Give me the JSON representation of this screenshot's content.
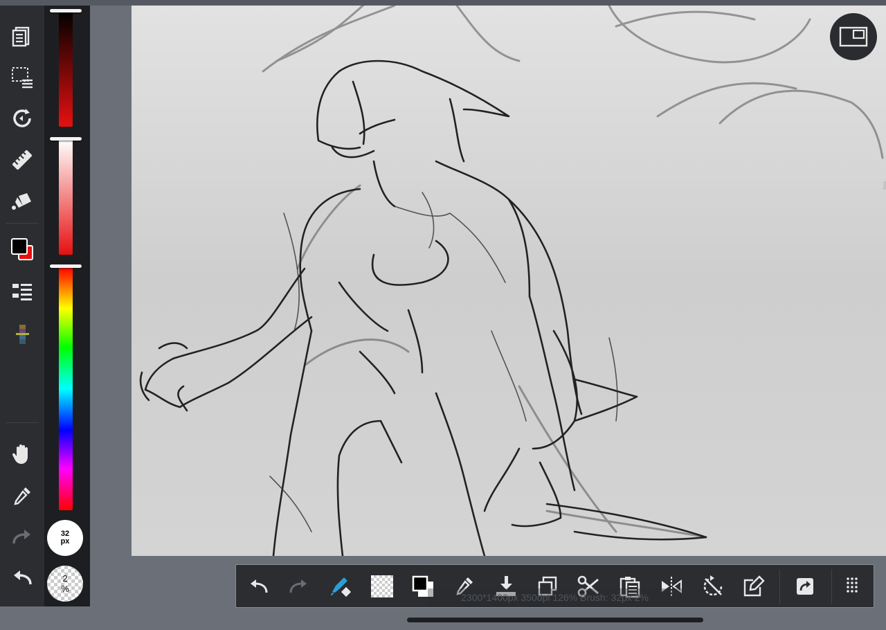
{
  "status_bar": {
    "text": "2300*1400px 350dpi 126% Brush: 32px 2%"
  },
  "brush": {
    "size_label": "32\npx",
    "opacity_value": "2",
    "opacity_unit": "%"
  },
  "colors": {
    "primary": "#000000",
    "secondary": "#e61010",
    "ui_dark": "#2b2d31",
    "accent_blue": "#2a9fd8"
  },
  "left_tools": [
    {
      "name": "layers-icon"
    },
    {
      "name": "selection-icon"
    },
    {
      "name": "transform-icon"
    },
    {
      "name": "ruler-icon"
    },
    {
      "name": "fill-icon"
    },
    {
      "name": "color-swatch"
    },
    {
      "name": "layer-list-icon"
    },
    {
      "name": "palette-icon"
    },
    {
      "name": "hand-icon"
    },
    {
      "name": "eyedropper-icon"
    },
    {
      "name": "redo-icon"
    },
    {
      "name": "undo-icon"
    }
  ],
  "bottom_tools": [
    {
      "name": "undo-icon"
    },
    {
      "name": "redo-icon"
    },
    {
      "name": "brush-eraser-icon"
    },
    {
      "name": "transparent-icon"
    },
    {
      "name": "color-swap-icon"
    },
    {
      "name": "eyedropper-icon"
    },
    {
      "name": "fill-layer-icon"
    },
    {
      "name": "copy-icon"
    },
    {
      "name": "cut-icon"
    },
    {
      "name": "paste-icon"
    },
    {
      "name": "flip-icon"
    },
    {
      "name": "rotate-reset-icon"
    },
    {
      "name": "edit-icon"
    },
    {
      "name": "share-icon"
    },
    {
      "name": "grid-menu-icon"
    }
  ]
}
